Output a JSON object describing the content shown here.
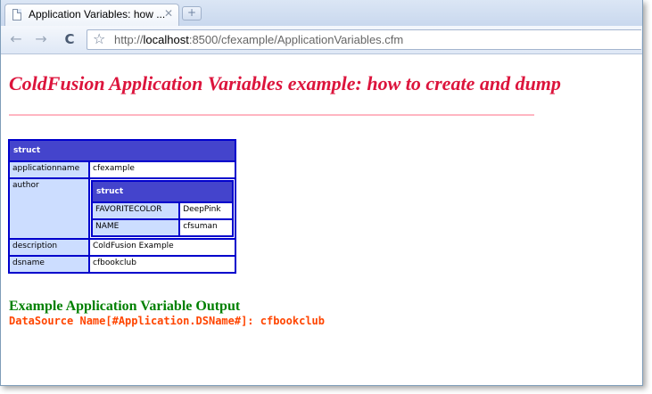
{
  "browser": {
    "tab_title": "Application Variables: how ...",
    "tab_close": "✕",
    "new_tab": "+",
    "back": "←",
    "forward": "→",
    "reload": "C",
    "star": "☆",
    "url": {
      "scheme": "http://",
      "host": "localhost",
      "rest": ":8500/cfexample/ApplicationVariables.cfm"
    }
  },
  "page": {
    "heading": "ColdFusion Application Variables example: how to create and dump",
    "dump": {
      "title": "struct",
      "rows": {
        "applicationname": {
          "key": "applicationname",
          "value": "cfexample"
        },
        "author": {
          "key": "author",
          "title": "struct",
          "rows": [
            {
              "key": "FAVORITECOLOR",
              "value": "DeepPink"
            },
            {
              "key": "NAME",
              "value": "cfsuman"
            }
          ]
        },
        "description": {
          "key": "description",
          "value": "ColdFusion Example"
        },
        "dsname": {
          "key": "dsname",
          "value": "cfbookclub"
        }
      }
    },
    "output_heading": "Example Application Variable Output",
    "output_line": "DataSource Name[#Application.DSName#]: cfbookclub"
  },
  "colors": {
    "heading": "#dc143c",
    "hr": "#ffb6c1",
    "dump_header": "#4444cc",
    "dump_border": "#0000cc",
    "dump_key": "#ccddff",
    "output_heading": "#008000",
    "output_line": "#ff4500"
  }
}
